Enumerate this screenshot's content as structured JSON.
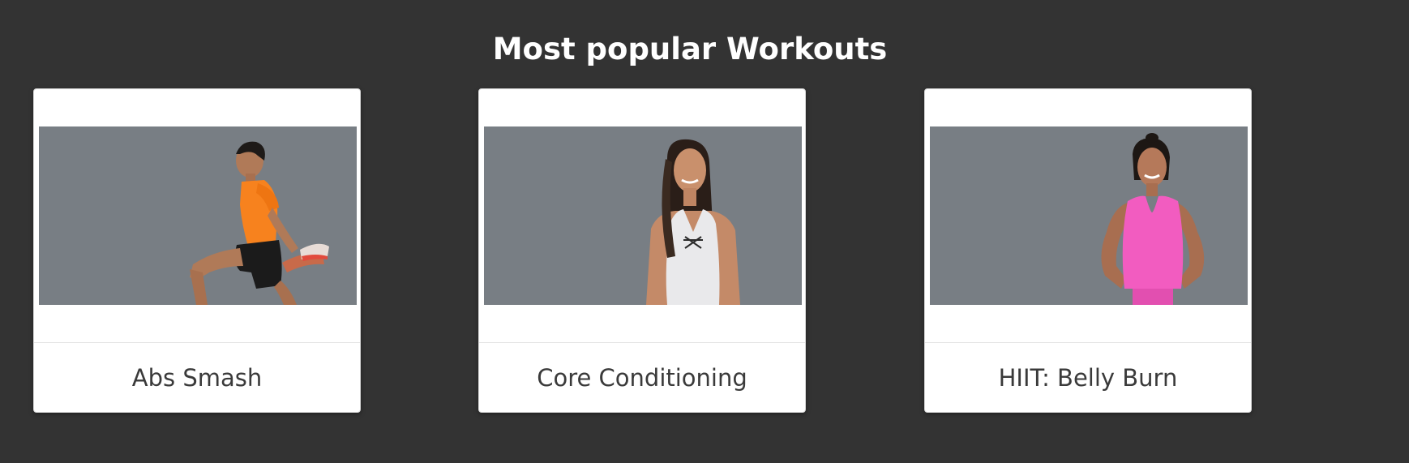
{
  "section": {
    "title": "Most popular Workouts"
  },
  "workouts": [
    {
      "title": "Abs Smash",
      "image_subject": "man in orange shirt stretching quad"
    },
    {
      "title": "Core Conditioning",
      "image_subject": "woman in white tank top"
    },
    {
      "title": "HIIT: Belly Burn",
      "image_subject": "woman in pink tank top, hands on hips"
    }
  ],
  "colors": {
    "page_background": "#333333",
    "card_background": "#ffffff",
    "image_background": "#787e84",
    "title_text": "#ffffff",
    "card_text": "#3a3a3a"
  }
}
